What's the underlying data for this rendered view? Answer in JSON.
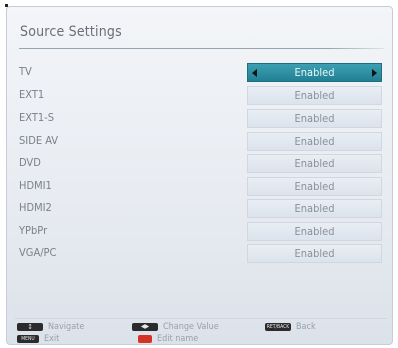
{
  "title": "Source Settings",
  "rows": [
    {
      "label": "TV",
      "value": "Enabled"
    },
    {
      "label": "EXT1",
      "value": "Enabled"
    },
    {
      "label": "EXT1-S",
      "value": "Enabled"
    },
    {
      "label": "SIDE AV",
      "value": "Enabled"
    },
    {
      "label": "DVD",
      "value": "Enabled"
    },
    {
      "label": "HDMI1",
      "value": "Enabled"
    },
    {
      "label": "HDMI2",
      "value": "Enabled"
    },
    {
      "label": "YPbPr",
      "value": "Enabled"
    },
    {
      "label": "VGA/PC",
      "value": "Enabled"
    }
  ],
  "selected_row": "TV",
  "footer": {
    "navigate": "Navigate",
    "change_value": "Change Value",
    "back": "Back",
    "back_key": "RET/BACK",
    "exit": "Exit",
    "exit_key": "MENU",
    "edit_name": "Edit name"
  },
  "colors": {
    "selected": "#2a8fa3",
    "edit_key": "#d43325"
  }
}
